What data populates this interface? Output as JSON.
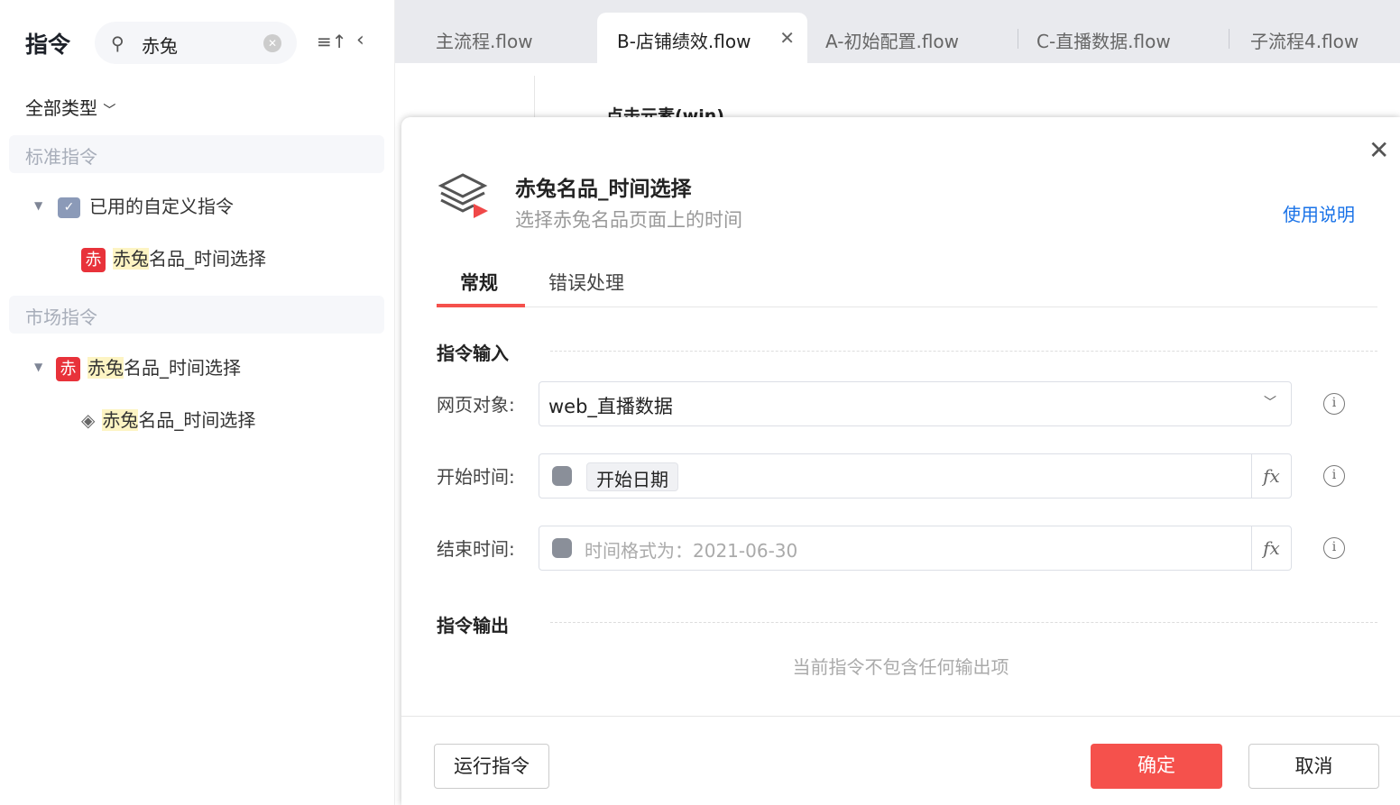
{
  "sidebar": {
    "title": "指令",
    "search_value": "赤兔",
    "type_filter": "全部类型",
    "sections": [
      {
        "label": "标准指令"
      },
      {
        "label": "市场指令"
      }
    ],
    "std_group": "已用的自定义指令",
    "badge": "赤",
    "hl": "赤兔",
    "rest": "名品_时间选择"
  },
  "tabs": [
    {
      "label": "主流程.flow"
    },
    {
      "label": "B-店铺绩效.flow"
    },
    {
      "label": "A-初始配置.flow"
    },
    {
      "label": "C-直播数据.flow"
    },
    {
      "label": "子流程4.flow"
    }
  ],
  "background": {
    "step_label": "点击元素(win)"
  },
  "modal": {
    "title": "赤兔名品_时间选择",
    "subtitle": "选择赤兔名品页面上的时间",
    "help": "使用说明",
    "tabs": [
      "常规",
      "错误处理"
    ],
    "input_section": "指令输入",
    "output_section": "指令输出",
    "fields": {
      "web_label": "网页对象:",
      "web_value": "web_直播数据",
      "start_label": "开始时间:",
      "start_value": "开始日期",
      "end_label": "结束时间:",
      "end_placeholder": "时间格式为：2021-06-30"
    },
    "no_output": "当前指令不包含任何输出项",
    "run": "运行指令",
    "ok": "确定",
    "cancel": "取消"
  }
}
